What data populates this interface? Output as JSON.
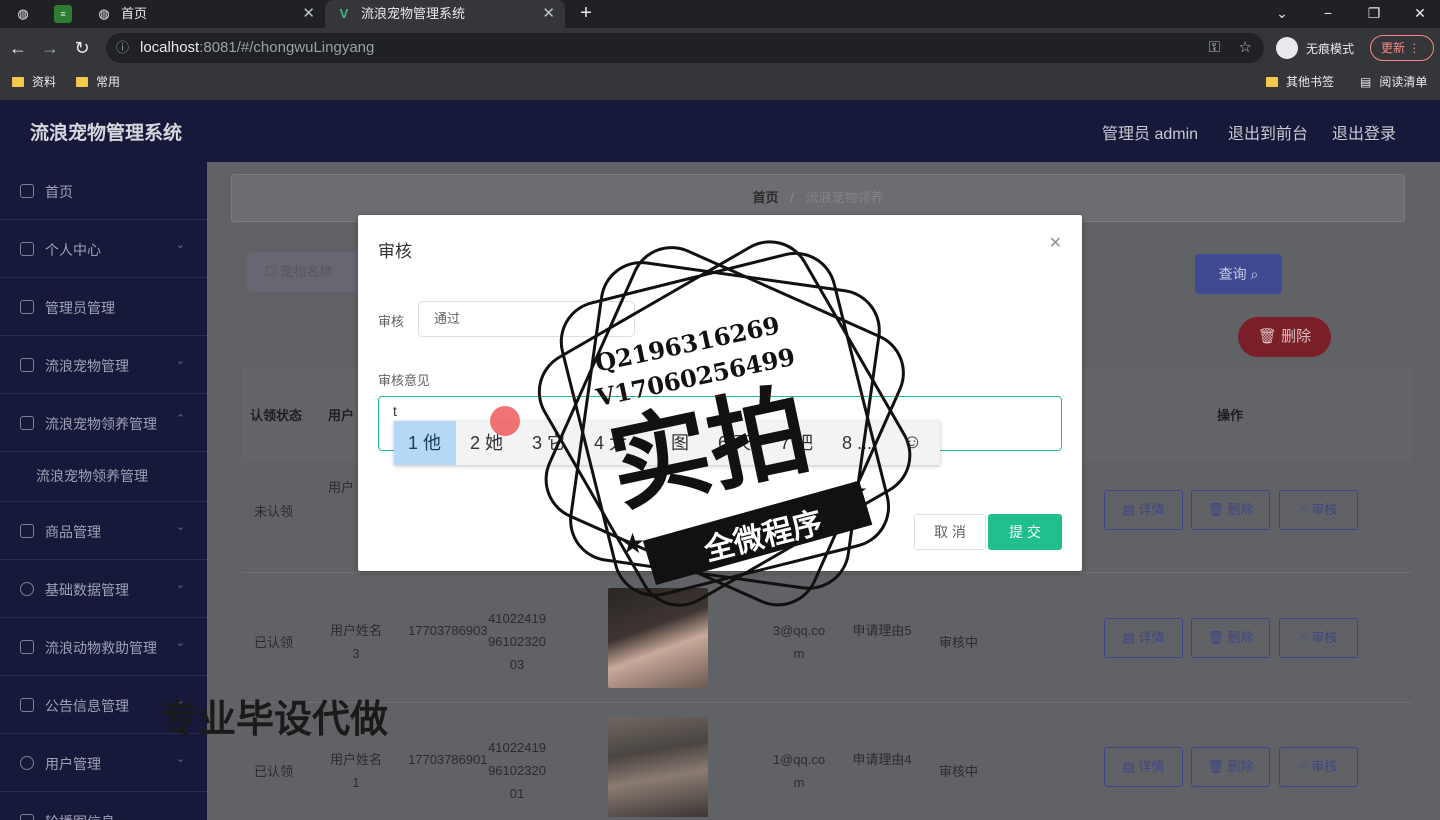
{
  "browser": {
    "tabs": [
      {
        "label": "首页"
      },
      {
        "label": "流浪宠物管理系统"
      }
    ],
    "url_host": "localhost",
    "url_rest": ":8081/#/chongwuLingyang",
    "incognito_label": "无痕模式",
    "update_label": "更新",
    "bookmarks": [
      "资料",
      "常用"
    ],
    "bookmarks_right": [
      "其他书签",
      "阅读清单"
    ]
  },
  "app": {
    "brand": "流浪宠物管理系统",
    "top_links": [
      "管理员 admin",
      "退出到前台",
      "退出登录"
    ]
  },
  "sidebar": {
    "items": [
      {
        "label": "首页"
      },
      {
        "label": "个人中心"
      },
      {
        "label": "管理员管理"
      },
      {
        "label": "流浪宠物管理"
      },
      {
        "label": "流浪宠物领养管理"
      },
      {
        "label": "流浪宠物领养管理"
      },
      {
        "label": "商品管理"
      },
      {
        "label": "基础数据管理"
      },
      {
        "label": "流浪动物救助管理"
      },
      {
        "label": "公告信息管理"
      },
      {
        "label": "用户管理"
      },
      {
        "label": "轮播图信息"
      }
    ]
  },
  "main": {
    "breadcrumb": {
      "home": "首页",
      "current": "流浪宠物领养"
    },
    "search_placeholder": "宠物名称",
    "query_button": "查询",
    "delete_button": "删除",
    "headers": {
      "status": "认领状态",
      "user": "用户",
      "action": "操作"
    },
    "rows": [
      {
        "status": "未认领",
        "user": "用户",
        "phone": "",
        "idcard": "",
        "email": "",
        "reason": "",
        "review": ""
      },
      {
        "status": "已认领",
        "user": "用户姓名3",
        "phone": "17703786903",
        "idcard": "410224199610232003",
        "email": "3@qq.com",
        "reason": "申请理由5",
        "review": "审核中"
      },
      {
        "status": "已认领",
        "user": "用户姓名1",
        "phone": "17703786901",
        "idcard": "410224199610232001",
        "email": "1@qq.com",
        "reason": "申请理由4",
        "review": "审核中"
      }
    ],
    "row_actions": {
      "detail": "详情",
      "delete": "删除",
      "review": "审核"
    }
  },
  "dialog": {
    "title": "审核",
    "review_label": "审核",
    "review_value": "通过",
    "opinion_label": "审核意见",
    "opinion_value": "t",
    "cancel": "取 消",
    "submit": "提 交",
    "ime_candidates": [
      "1 他",
      "2 她",
      "3 它",
      "4 太",
      "5 图",
      "6 天",
      "7 吧",
      "8 ..."
    ]
  },
  "overlay": {
    "bottom_text": "专业毕设代做",
    "stamp_line1": "Q2196316269",
    "stamp_line2": "V17060256499",
    "stamp_big": "实拍",
    "stamp_ribbon": "全微程序"
  },
  "colors": {
    "accent": "#1fc08e",
    "topbar": "#16193a",
    "primary": "#3f4a93",
    "danger": "#7a1f27"
  }
}
